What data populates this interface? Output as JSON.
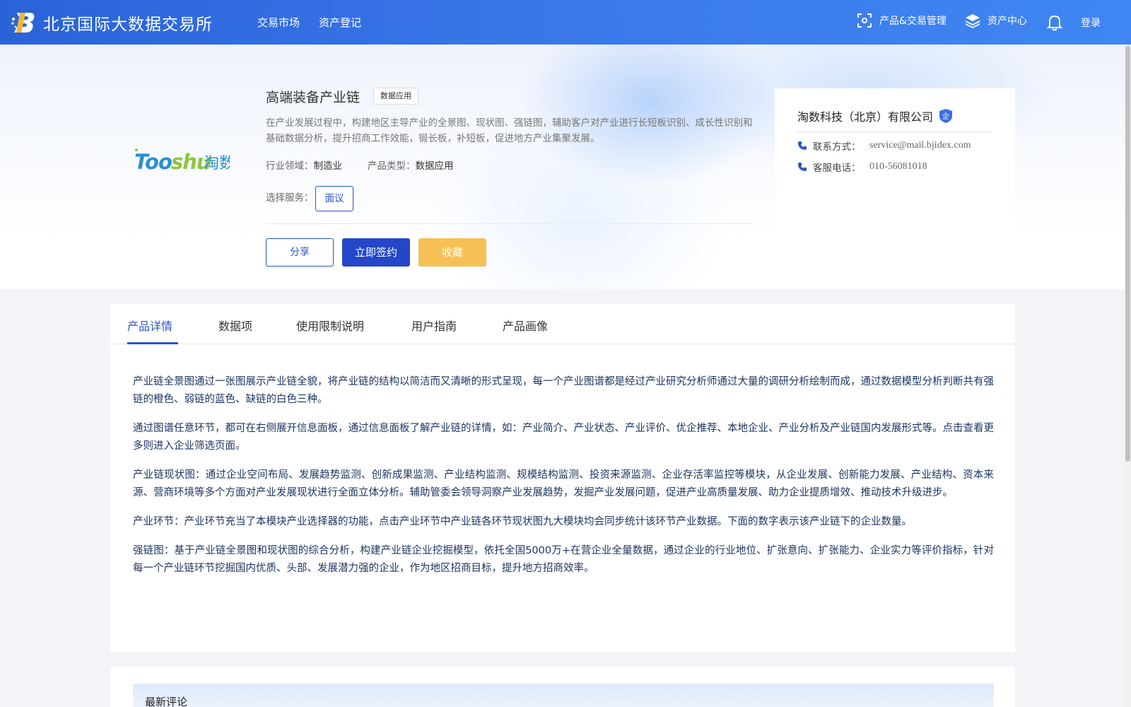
{
  "header": {
    "brand": "北京国际大数据交易所",
    "nav": [
      "交易市场",
      "资产登记"
    ],
    "product_mgmt": "产品&交易管理",
    "asset_center": "资产中心",
    "login": "登录"
  },
  "product": {
    "logo_text": "Tooshu淘数",
    "title": "高端装备产业链",
    "tag": "数据应用",
    "description": "在产业发展过程中，构建地区主导产业的全景图、现状图、强链图，辅助客户对产业进行长短板识别、成长性识别和基础数据分析，提升招商工作效能，锻长板，补短板，促进地方产业集聚发展。",
    "industry_label": "行业领域：",
    "industry_value": "制造业",
    "type_label": "产品类型：",
    "type_value": "数据应用",
    "service_label": "选择服务：",
    "service_option": "面议",
    "share": "分享",
    "sign": "立即签约",
    "favorite": "收藏"
  },
  "company": {
    "name": "淘数科技（北京）有限公司",
    "badge": "企",
    "contact_label": "联系方式：",
    "contact_value": "service@mail.bjidex.com",
    "phone_label": "客服电话：",
    "phone_value": "010-56081018"
  },
  "tabs": [
    "产品详情",
    "数据项",
    "使用限制说明",
    "用户指南",
    "产品画像"
  ],
  "content": [
    "产业链全景图通过一张图展示产业链全貌，将产业链的结构以简洁而又清晰的形式呈现，每一个产业图谱都是经过产业研究分析师通过大量的调研分析绘制而成，通过数据模型分析判断共有强链的橙色、弱链的蓝色、缺链的白色三种。",
    "通过图谱任意环节，都可在右侧展开信息面板，通过信息面板了解产业链的详情，如：产业简介、产业状态、产业评价、优企推荐、本地企业、产业分析及产业链国内发展形式等。点击查看更多则进入企业筛选页面。",
    "产业链现状图：通过企业空间布局、发展趋势监测、创新成果监测、产业结构监测、规模结构监测、投资来源监测、企业存活率监控等模块，从企业发展、创新能力发展、产业结构、资本来源、营商环境等多个方面对产业发展现状进行全面立体分析。辅助管委会领导洞察产业发展趋势，发掘产业发展问题，促进产业高质量发展、助力企业提质增效、推动技术升级进步。",
    "产业环节：产业环节充当了本模块产业选择器的功能，点击产业环节中产业链各环节现状图九大模块均会同步统计该环节产业数据。下面的数字表示该产业链下的企业数量。",
    "强链图：基于产业链全景图和现状图的综合分析，构建产业链企业挖掘模型，依托全国5000万+在营企业全量数据，通过企业的行业地位、扩张意向、扩张能力、企业实力等评价指标，针对每一个产业链环节挖掘国内优质、头部、发展潜力强的企业，作为地区招商目标，提升地方招商效率。"
  ],
  "comments": {
    "title": "最新评论"
  }
}
